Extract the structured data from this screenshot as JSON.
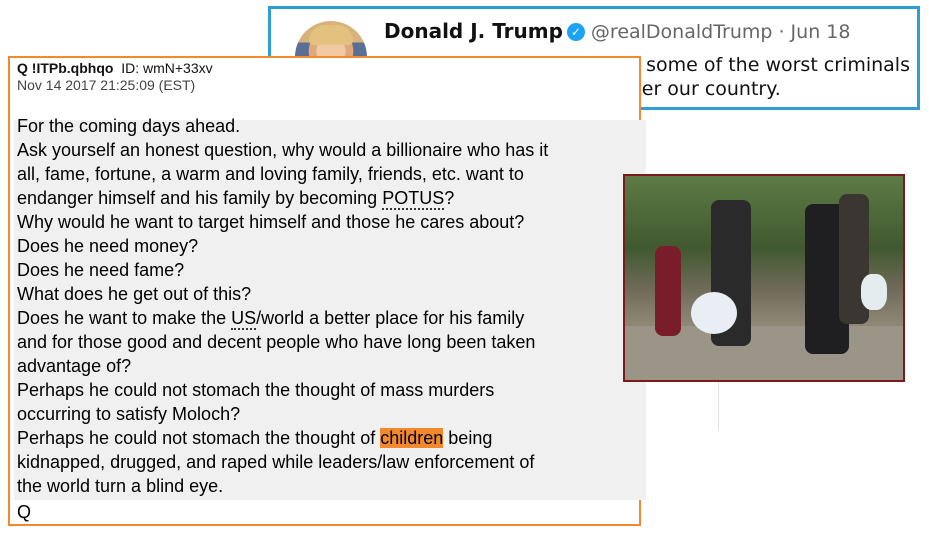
{
  "qpost": {
    "name": "Q !ITPb.qbhqo",
    "id": "ID: wmN+33xv",
    "date": "Nov 14 2017 21:25:09 (EST)",
    "lines": [
      {
        "pre": "For the coming days ahead.",
        "mark": "",
        "post": ""
      },
      {
        "pre": "Ask yourself an honest question, why would a billionaire who has it",
        "mark": "",
        "post": ""
      },
      {
        "pre": "all, fame, fortune, a warm and loving family, friends, etc. want to",
        "mark": "",
        "post": ""
      },
      {
        "pre": "endanger himself and his family by becoming ",
        "mark": "POTUS",
        "post": "?"
      },
      {
        "pre": "Why would he want to target himself and those he cares about?",
        "mark": "",
        "post": ""
      },
      {
        "pre": "Does he need money?",
        "mark": "",
        "post": ""
      },
      {
        "pre": "Does he need fame?",
        "mark": "",
        "post": ""
      },
      {
        "pre": "What does he get out of this?",
        "mark": "",
        "post": ""
      },
      {
        "pre": "Does he want to make the ",
        "mark": "US",
        "post": "/world a better place for his family"
      },
      {
        "pre": "and for those good and decent people who have long been taken",
        "mark": "",
        "post": ""
      },
      {
        "pre": "advantage of?",
        "mark": "",
        "post": ""
      },
      {
        "pre": "Perhaps he could not stomach the thought of mass murders",
        "mark": "",
        "post": ""
      },
      {
        "pre": "occurring to satisfy Moloch?",
        "mark": "",
        "post": ""
      },
      {
        "pre": "Perhaps he could not stomach the thought of ",
        "highlight": "children",
        "post": " being"
      },
      {
        "pre": "kidnapped, drugged, and raped while leaders/law enforcement of",
        "mark": "",
        "post": ""
      },
      {
        "pre": "the world turn a blind eye.",
        "mark": "",
        "post": ""
      }
    ],
    "signature": "Q"
  },
  "tweet": {
    "name": "Donald J. Trump",
    "verified_glyph": "✓",
    "handle": "@realDonaldTrump · Jun 18",
    "text_line1": "Children are being used by some of the worst criminals",
    "text_line2": "on earth as a means to  enter our country."
  },
  "colors": {
    "qpost_border": "#f28a2d",
    "highlight": "#f28a2d",
    "tweet_border": "#2e9fd6",
    "photo_border": "#7a1a1a"
  }
}
